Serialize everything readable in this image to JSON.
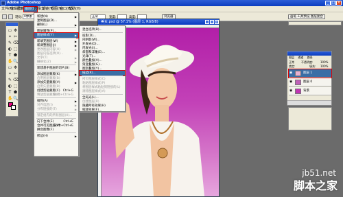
{
  "window": {
    "title": "Adobe Photoshop"
  },
  "menubar": {
    "items": [
      "文件(F)",
      "编辑(E)",
      "图像(I)",
      "图层(L)",
      "选择(S)",
      "滤镜(T)",
      "视图(V)",
      "窗口(W)",
      "帮助(H)"
    ],
    "active_index": 3
  },
  "options": {
    "feather_label": "羽化:",
    "feather_value": "0像素",
    "style_value": "正常",
    "width_label": "宽度:",
    "height_label": "高度:",
    "browser_button": "浏览器",
    "palette_button": "画笔  工具预设  图层复合"
  },
  "document": {
    "title": "美女.psd @ 57.1% (图层 1, RGB/8)"
  },
  "layer_menu": {
    "items": [
      {
        "label": "新建(N)",
        "disabled": false,
        "arrow": true
      },
      {
        "label": "复制图层(D)...",
        "disabled": false
      },
      {
        "label": "删除(L)",
        "disabled": false,
        "arrow": true
      },
      {
        "sep": true
      },
      {
        "label": "图层属性(P)...",
        "disabled": false
      },
      {
        "label": "图层样式(Y)",
        "disabled": false,
        "arrow": true,
        "highlight": true
      },
      {
        "sep": true
      },
      {
        "label": "新填充图层(W)",
        "disabled": false,
        "arrow": true
      },
      {
        "label": "新调整图层(J)",
        "disabled": false,
        "arrow": true
      },
      {
        "label": "更改图层内容(H)",
        "disabled": true,
        "arrow": true
      },
      {
        "label": "图层内容选项(O)...",
        "disabled": true
      },
      {
        "label": "文字(T)",
        "disabled": true,
        "arrow": true
      },
      {
        "label": "栅格化(Z)",
        "disabled": true,
        "arrow": true
      },
      {
        "sep": true
      },
      {
        "label": "新建基于图层的切片(B)",
        "disabled": false
      },
      {
        "sep": true
      },
      {
        "label": "添加图层蒙版(K)",
        "disabled": false,
        "arrow": true
      },
      {
        "label": "启用图层蒙版(B)",
        "disabled": true
      },
      {
        "label": "添加矢量蒙版(V)",
        "disabled": false,
        "arrow": true
      },
      {
        "label": "启用矢量蒙版(B)",
        "disabled": true
      },
      {
        "label": "创建剪贴蒙版(C)",
        "shortcut": "Ctrl+G",
        "disabled": false
      },
      {
        "label": "释放剪贴蒙版(C)",
        "shortcut": "Shift+Ctrl+G",
        "disabled": true
      },
      {
        "sep": true
      },
      {
        "label": "排列(A)",
        "disabled": false,
        "arrow": true
      },
      {
        "label": "对齐选区(I)",
        "disabled": true,
        "arrow": true
      },
      {
        "label": "分布链接的(T)",
        "disabled": true,
        "arrow": true
      },
      {
        "sep": true
      },
      {
        "label": "锁定组内的所有图层(X)...",
        "disabled": true
      },
      {
        "sep": true
      },
      {
        "label": "向下合并(E)",
        "shortcut": "Ctrl+E",
        "disabled": false
      },
      {
        "label": "合并可见图层(V)",
        "shortcut": "Shift+Ctrl+E",
        "disabled": false
      },
      {
        "label": "拼合图像(F)",
        "disabled": false
      },
      {
        "sep": true
      },
      {
        "label": "修边(H)",
        "disabled": false,
        "arrow": true
      }
    ]
  },
  "style_submenu": {
    "items": [
      {
        "label": "混合选项(B)...",
        "disabled": false
      },
      {
        "sep": true
      },
      {
        "label": "投影(D)...",
        "disabled": false
      },
      {
        "label": "内阴影(W)...",
        "disabled": false
      },
      {
        "label": "外发光(O)...",
        "disabled": false
      },
      {
        "label": "内发光(I)...",
        "disabled": false
      },
      {
        "label": "斜面和浮雕(E)...",
        "disabled": false
      },
      {
        "label": "光泽(T)...",
        "disabled": false
      },
      {
        "label": "颜色叠加(V)...",
        "disabled": false
      },
      {
        "label": "渐变叠加(G)...",
        "disabled": false
      },
      {
        "label": "图案叠加(Y)...",
        "disabled": false
      },
      {
        "label": "描边(K)...",
        "disabled": false,
        "highlight": true
      },
      {
        "sep": true
      },
      {
        "label": "拷贝图层样式(C)",
        "disabled": true
      },
      {
        "label": "粘贴图层样式(P)",
        "disabled": true
      },
      {
        "label": "将图层样式粘贴到链接的(L)",
        "disabled": true
      },
      {
        "label": "清除图层样式(A)",
        "disabled": true
      },
      {
        "sep": true
      },
      {
        "label": "全局光(L)...",
        "disabled": false
      },
      {
        "label": "创建图层(R)",
        "disabled": true
      },
      {
        "label": "隐藏所有效果(H)",
        "disabled": false
      },
      {
        "label": "缩放效果(F)...",
        "disabled": false
      }
    ]
  },
  "layers_panel": {
    "tabs": [
      "图层",
      "通道",
      "路径"
    ],
    "blend_mode": "正常",
    "opacity_label": "不透明度:",
    "opacity_value": "100%",
    "lock_label": "锁定:",
    "fill_label": "填充:",
    "fill_value": "100%",
    "layers": [
      {
        "name": "图层 1",
        "selected": true,
        "thumb": "#e8b0d0"
      },
      {
        "name": "图层 0",
        "selected": false,
        "thumb": "#c060b8"
      },
      {
        "name": "背景",
        "selected": false,
        "thumb": "#c035b3"
      }
    ]
  },
  "watermark": {
    "site": "jb51.net",
    "name": "脚本之家"
  },
  "colors": {
    "accent": "#3a6ea5",
    "foreground": "#e4057f",
    "canvas_top": "#b21fa8",
    "canvas_bottom": "#e6a6de"
  }
}
